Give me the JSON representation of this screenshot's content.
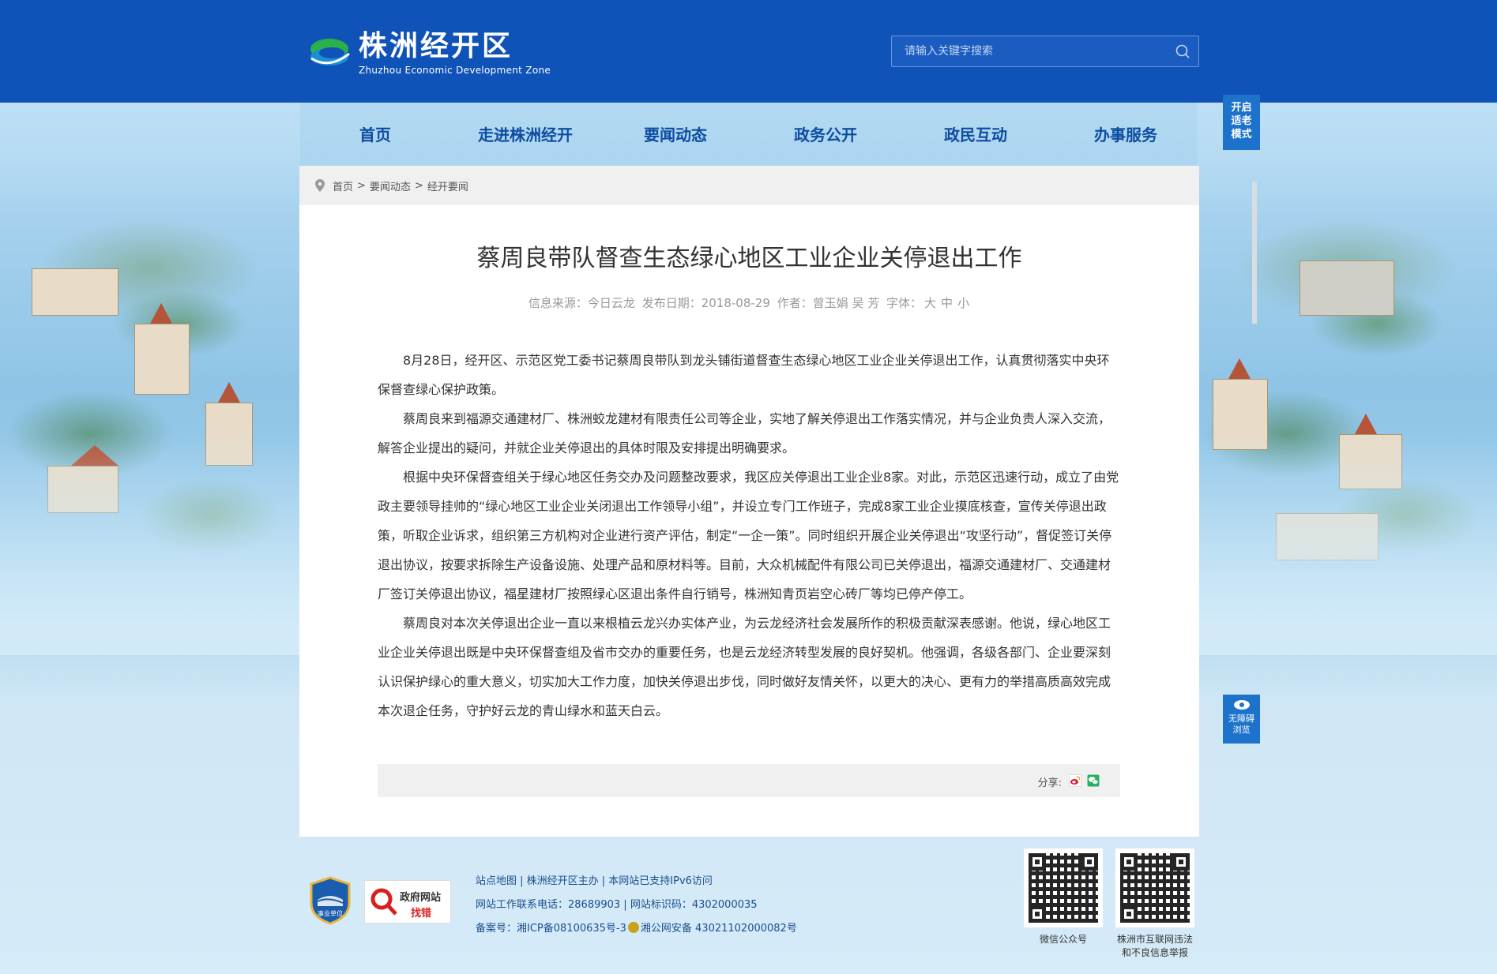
{
  "header": {
    "logo_cn": "株洲经开区",
    "logo_en": "Zhuzhou Economic Development Zone",
    "search_placeholder": "请输入关键字搜索"
  },
  "nav": {
    "items": [
      "首页",
      "走进株洲经开",
      "要闻动态",
      "政务公开",
      "政民互动",
      "办事服务"
    ]
  },
  "side": {
    "elder_mode": [
      "开启",
      "适老",
      "模式"
    ],
    "barrier_free": [
      "无障碍",
      "浏览"
    ]
  },
  "breadcrumb": [
    "首页",
    ">",
    "要闻动态",
    ">",
    "经开要闻"
  ],
  "article": {
    "title": "蔡周良带队督查生态绿心地区工业企业关停退出工作",
    "meta_source": "信息来源：今日云龙",
    "meta_date": "发布日期：2018-08-29",
    "meta_author": "作者：曾玉娟 吴 芳",
    "meta_font_label": "字体：",
    "font_sizes": [
      "大",
      "中",
      "小"
    ],
    "paragraphs": [
      "8月28日，经开区、示范区党工委书记蔡周良带队到龙头铺街道督查生态绿心地区工业企业关停退出工作，认真贯彻落实中央环保督查绿心保护政策。",
      "蔡周良来到福源交通建材厂、株洲蛟龙建材有限责任公司等企业，实地了解关停退出工作落实情况，并与企业负责人深入交流，解答企业提出的疑问，并就企业关停退出的具体时限及安排提出明确要求。",
      "根据中央环保督查组关于绿心地区任务交办及问题整改要求，我区应关停退出工业企业8家。对此，示范区迅速行动，成立了由党政主要领导挂帅的“绿心地区工业企业关闭退出工作领导小组”，并设立专门工作班子，完成8家工业企业摸底核查，宣传关停退出政策，听取企业诉求，组织第三方机构对企业进行资产评估，制定“一企一策”。同时组织开展企业关停退出“攻坚行动”，督促签订关停退出协议，按要求拆除生产设备设施、处理产品和原材料等。目前，大众机械配件有限公司已关停退出，福源交通建材厂、交通建材厂签订关停退出协议，福星建材厂按照绿心区退出条件自行销号，株洲知青页岩空心砖厂等均已停产停工。",
      "蔡周良对本次关停退出企业一直以来根植云龙兴办实体产业，为云龙经济社会发展所作的积极贡献深表感谢。他说，绿心地区工业企业关停退出既是中央环保督查组及省市交办的重要任务，也是云龙经济转型发展的良好契机。他强调，各级各部门、企业要深刻认识保护绿心的重大意义，切实加大工作力度，加快关停退出步伐，同时做好友情关怀，以更大的决心、更有力的举措高质高效完成本次退企任务，守护好云龙的青山绿水和蓝天白云。"
    ],
    "share_label": "分享:"
  },
  "footer": {
    "badge_unit": "事业单位",
    "badge_gov_1": "政府网站",
    "badge_gov_2": "找错",
    "line1": "站点地图 | 株洲经开区主办 | 本网站已支持IPv6访问",
    "line2": "网站工作联系电话：28689903 | 网站标识码：4302000035",
    "line3_a": "备案号：湘ICP备08100635号-3",
    "line3_b": "湘公网安备 43021102000082号",
    "qr1_label": "微信公众号",
    "qr2_label_1": "株洲市互联网违法",
    "qr2_label_2": "和不良信息举报"
  },
  "colors": {
    "header_blue": "#0f52b8",
    "nav_text": "#0d4da0",
    "side_button": "#1d73cc"
  }
}
